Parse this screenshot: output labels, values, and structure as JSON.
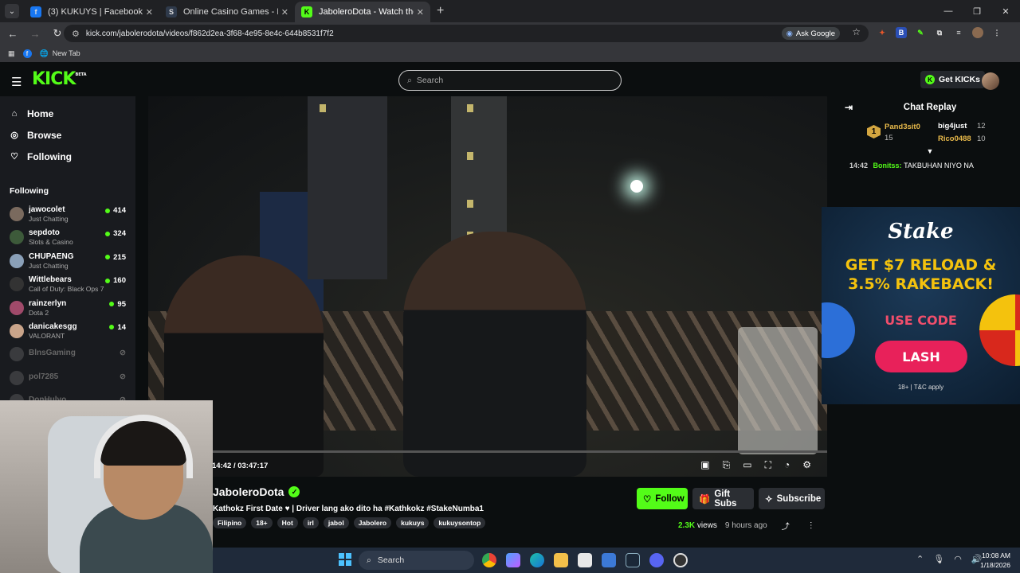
{
  "browser": {
    "tabs": [
      {
        "title": "(3) KUKUYS | Facebook",
        "favicon": "facebook-icon",
        "favicon_color": "#1877f2",
        "active": false
      },
      {
        "title": "Online Casino Games - Play Free",
        "favicon": "stake-icon",
        "favicon_color": "#2f3a4b",
        "active": false
      },
      {
        "title": "JaboleroDota - Watch the Video",
        "favicon": "kick-icon",
        "favicon_color": "#53fc18",
        "active": true
      }
    ],
    "url": "kick.com/jabolerodota/videos/f862d2ea-3f68-4e95-8e4c-644b8531f7f2",
    "ask_google": "Ask Google",
    "bookmarks": [
      {
        "label": "New Tab",
        "icon": "globe-icon"
      }
    ]
  },
  "kick": {
    "logo": "KICK",
    "logo_badge": "BETA",
    "search_placeholder": "Search",
    "get_kicks": "Get KICKs",
    "nav": [
      {
        "label": "Home",
        "icon": "home-icon"
      },
      {
        "label": "Browse",
        "icon": "compass-icon"
      },
      {
        "label": "Following",
        "icon": "heart-icon"
      }
    ],
    "following_heading": "Following",
    "following": [
      {
        "name": "jawocolet",
        "category": "Just Chatting",
        "viewers": "414",
        "live": true,
        "color": "#7a6a5e"
      },
      {
        "name": "sepdoto",
        "category": "Slots & Casino",
        "viewers": "324",
        "live": true,
        "color": "#3d5a3a"
      },
      {
        "name": "CHUPAENG",
        "category": "Just Chatting",
        "viewers": "215",
        "live": true,
        "color": "#8aa0b8"
      },
      {
        "name": "Wittlebears",
        "category": "Call of Duty: Black Ops 7",
        "viewers": "160",
        "live": true,
        "color": "#333"
      },
      {
        "name": "rainzerlyn",
        "category": "Dota 2",
        "viewers": "95",
        "live": true,
        "color": "#a04a6a"
      },
      {
        "name": "danicakesgg",
        "category": "VALORANT",
        "viewers": "14",
        "live": true,
        "color": "#c9a48a"
      },
      {
        "name": "BlnsGaming",
        "category": "",
        "viewers": "",
        "live": false,
        "color": "#777"
      },
      {
        "name": "pol7285",
        "category": "",
        "viewers": "",
        "live": false,
        "color": "#777"
      },
      {
        "name": "DonHulyo",
        "category": "",
        "viewers": "",
        "live": false,
        "color": "#777"
      }
    ],
    "player": {
      "current_time": "14:42",
      "duration": "03:47:17",
      "progress": 0.065
    },
    "stream": {
      "channel": "JaboleroDota",
      "title": "Kathokz First Date ♥ | Driver lang ako dito ha #Kathkokz #StakeNumba1",
      "tags": [
        "Filipino",
        "18+",
        "Hot",
        "irl",
        "jabol",
        "Jabolero",
        "kukuys",
        "kukuysontop"
      ],
      "views": "2.3K",
      "views_label": "views",
      "ago": "9 hours ago",
      "follow": "Follow",
      "gift_subs": "Gift Subs",
      "subscribe": "Subscribe"
    },
    "chat": {
      "title": "Chat Replay",
      "leaderboard": [
        {
          "rank": "1",
          "name": "Pand3sit0",
          "count": "15"
        },
        {
          "name": "big4just",
          "count": "12"
        },
        {
          "name": "Rico0488",
          "count": "10"
        }
      ],
      "messages": [
        {
          "time": "14:42",
          "user": "Bonitss:",
          "text": "TAKBUHAN NIYO NA"
        }
      ]
    },
    "ad": {
      "brand": "Stake",
      "headline1": "GET $7 RELOAD &",
      "headline2": "3.5% RAKEBACK!",
      "use_code": "USE CODE",
      "code": "LASH",
      "fine": "18+ | T&C apply"
    }
  },
  "taskbar": {
    "search": "Search",
    "time": "10:08 AM",
    "date": "1/18/2026"
  }
}
